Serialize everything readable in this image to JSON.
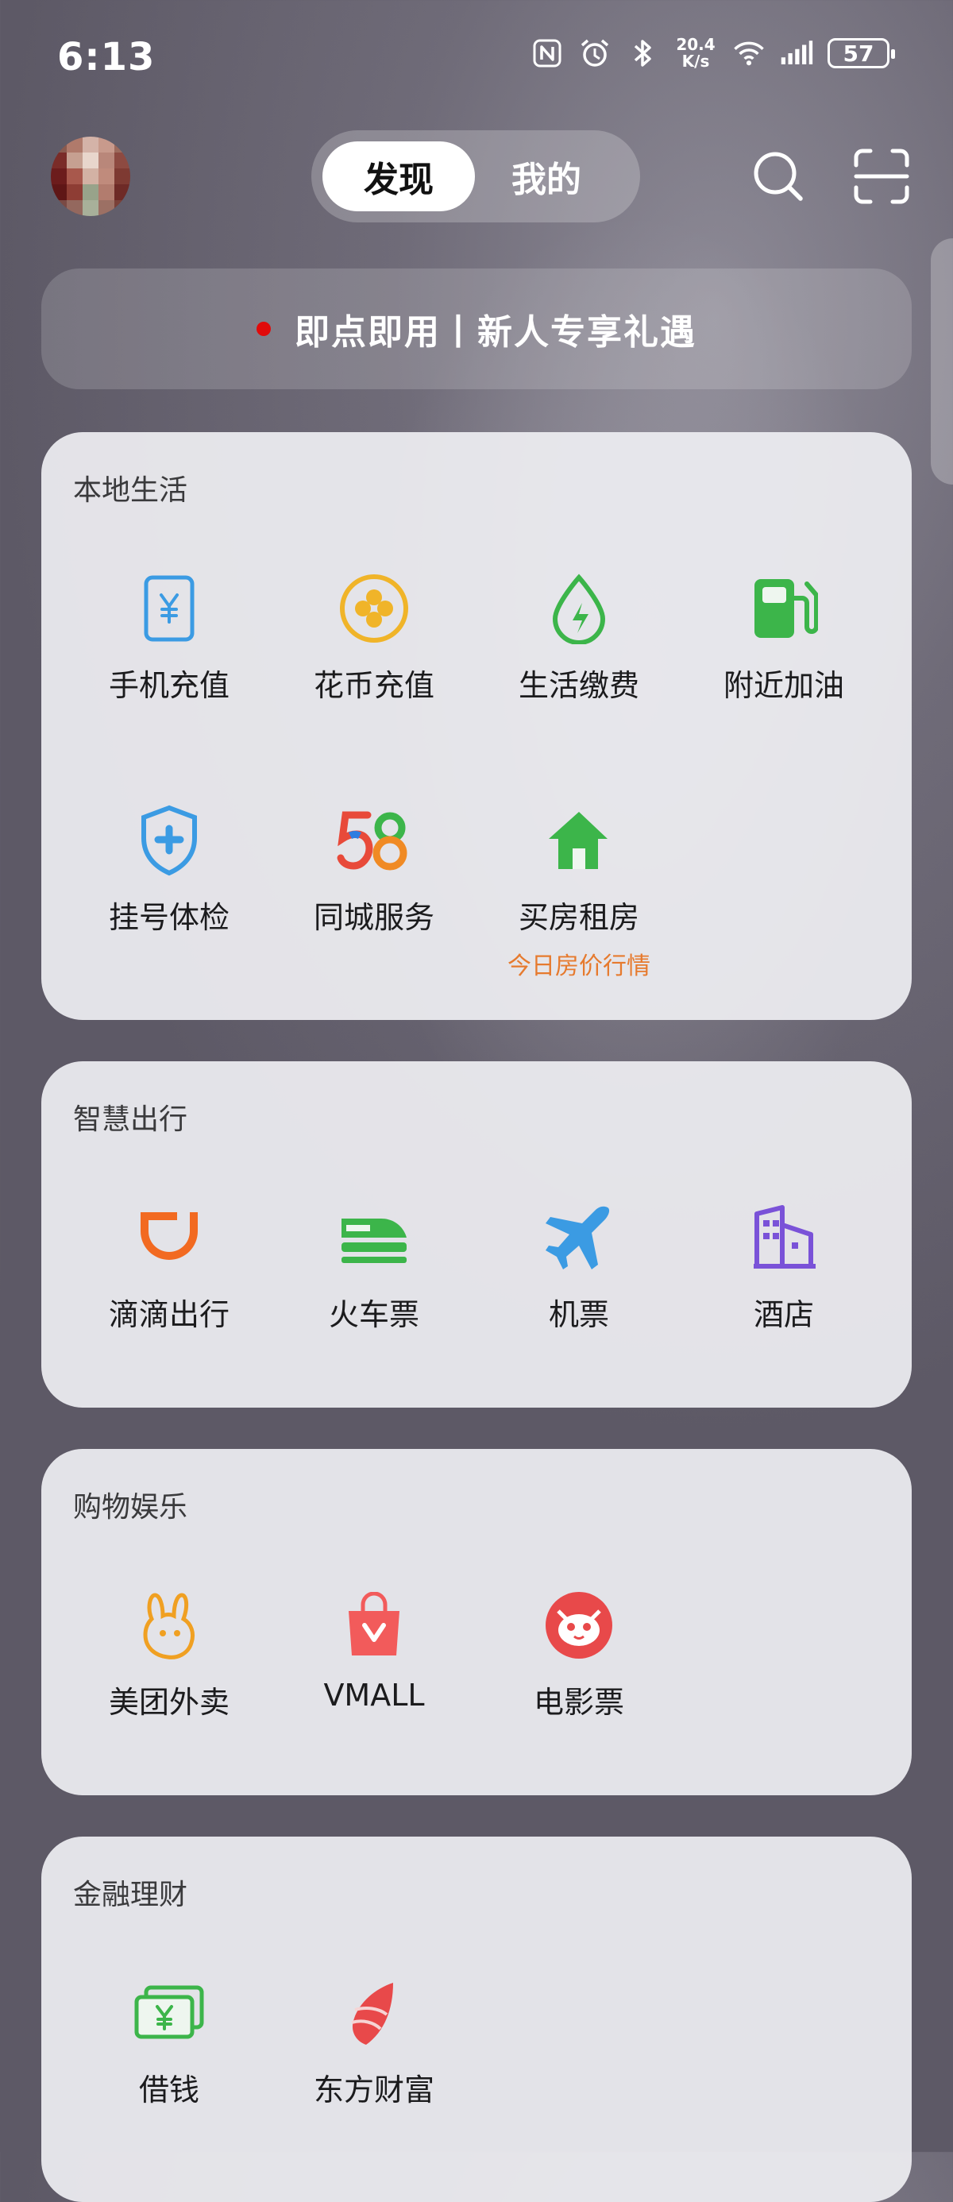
{
  "status_bar": {
    "time": "6:13",
    "net_speed_value": "20.4",
    "net_speed_unit": "K/s",
    "battery": "57",
    "icons": [
      "nfc-icon",
      "alarm-icon",
      "bluetooth-icon",
      "wifi-icon",
      "signal-icon",
      "battery-icon"
    ]
  },
  "header": {
    "tab_discover": "发现",
    "tab_mine": "我的",
    "active_tab": "发现"
  },
  "banner": {
    "text": "即点即用丨新人专享礼遇",
    "dot_color": "#e10a0a"
  },
  "sections": {
    "local": {
      "title": "本地生活",
      "items": [
        {
          "label": "手机充值",
          "icon": "phone-recharge-icon"
        },
        {
          "label": "花币充值",
          "icon": "coin-recharge-icon"
        },
        {
          "label": "生活缴费",
          "icon": "utility-bill-icon"
        },
        {
          "label": "附近加油",
          "icon": "gas-station-icon"
        },
        {
          "label": "挂号体检",
          "icon": "medical-shield-icon"
        },
        {
          "label": "同城服务",
          "icon": "58-logo-icon"
        },
        {
          "label": "买房租房",
          "icon": "house-icon",
          "sub": "今日房价行情"
        }
      ]
    },
    "travel": {
      "title": "智慧出行",
      "items": [
        {
          "label": "滴滴出行",
          "icon": "didi-icon"
        },
        {
          "label": "火车票",
          "icon": "train-icon"
        },
        {
          "label": "机票",
          "icon": "airplane-icon"
        },
        {
          "label": "酒店",
          "icon": "hotel-icon"
        }
      ]
    },
    "shopping": {
      "title": "购物娱乐",
      "items": [
        {
          "label": "美团外卖",
          "icon": "meituan-waimai-icon"
        },
        {
          "label": "VMALL",
          "icon": "vmall-bag-icon"
        },
        {
          "label": "电影票",
          "icon": "movie-cat-icon"
        }
      ]
    },
    "finance": {
      "title": "金融理财",
      "items": [
        {
          "label": "借钱",
          "icon": "loan-money-icon"
        },
        {
          "label": "东方财富",
          "icon": "eastmoney-icon"
        }
      ]
    }
  },
  "colors": {
    "accent_orange": "#e67a2e",
    "icon_blue": "#3b9be3",
    "icon_green": "#3cb54a",
    "icon_yellow": "#f0b429"
  }
}
